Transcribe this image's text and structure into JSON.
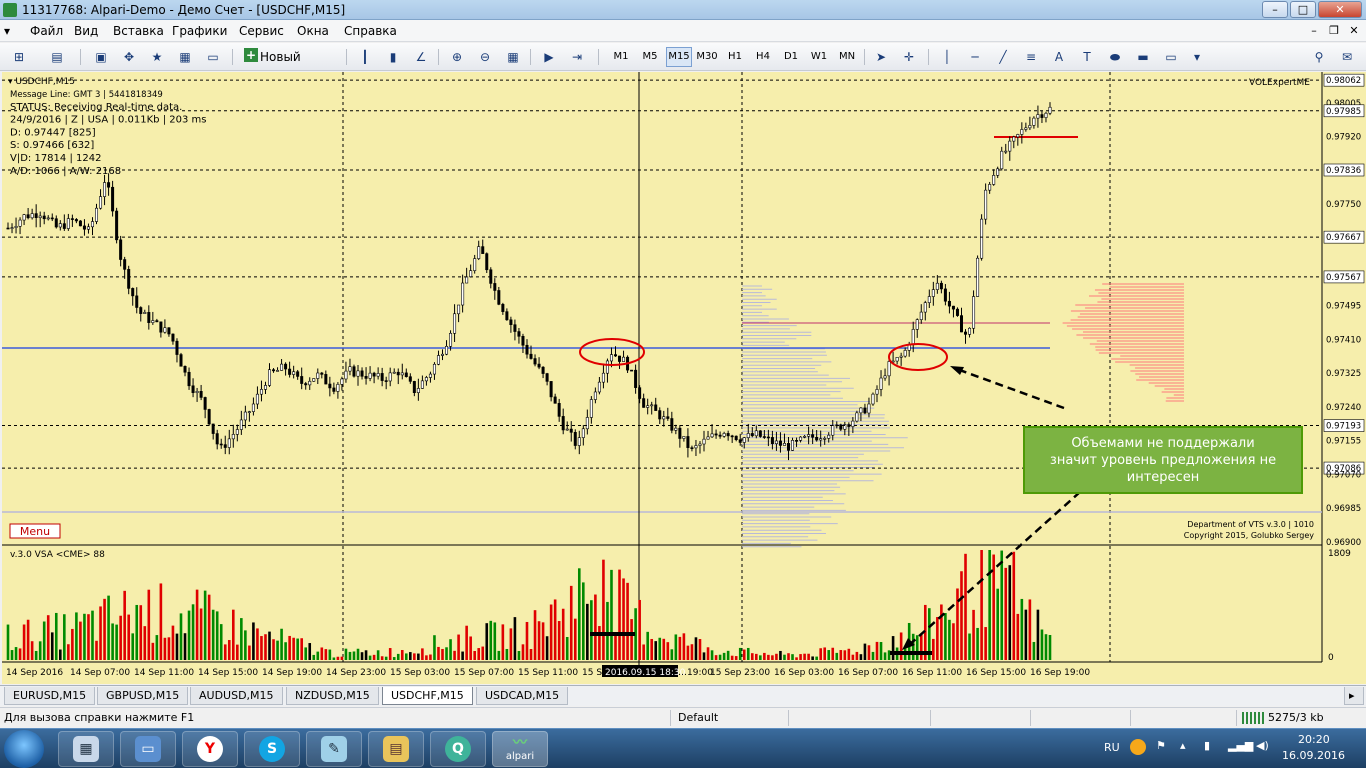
{
  "window": {
    "title": "11317768: Alpari-Demo - Демо Счет - [USDCHF,M15]",
    "controls": {
      "minimize": "–",
      "maximize": "□",
      "close": "✕"
    }
  },
  "menu": {
    "items": [
      "Файл",
      "Вид",
      "Вставка",
      "Графики",
      "Сервис",
      "Окна",
      "Справка"
    ],
    "mdi_controls": [
      "–",
      "❐",
      "✕"
    ]
  },
  "toolbar": {
    "new_order_label": "Новый ордер",
    "timeframes": [
      "M1",
      "M5",
      "M15",
      "M30",
      "H1",
      "H4",
      "D1",
      "W1",
      "MN"
    ],
    "active_timeframe": "M15",
    "text_tool": "A"
  },
  "chart_header": {
    "symbol": "USDCHF,M15",
    "info_lines": [
      "Message Line: GMT 3 | 5441818349",
      "STATUS:  Receiving Real-time data.",
      "24/9/2016 | Z | USA | 0.011Kb | 203 ms",
      "D: 0.97447  [825]",
      "S: 0.97466  [632]",
      "V|D: 17814 | 1242",
      "A/D: 1066 | A/W: 2168"
    ],
    "expert_name": "VOLExpertME",
    "menu_button": "Menu",
    "copyright_lines": [
      "Department of VTS  v.3.0 | 1010",
      "Copyright 2015, Golubko Sergey"
    ]
  },
  "annotation": {
    "text_lines": [
      "Объемами не поддержали",
      "значит уровень предложения не",
      "интересен"
    ],
    "colors": {
      "border": "#4e9a06",
      "text": "#ffffff",
      "fill": "#7cb342"
    }
  },
  "colors": {
    "chart_bg": "#f6eeac",
    "candles": "#000000",
    "level_line": "#3b5bdb",
    "red": "#e00000",
    "green": "#008a00",
    "volume_profile": "#b8b9d8"
  },
  "chart_data": [
    {
      "type": "candlestick",
      "series": [
        {
          "name": "USDCHF,M15"
        }
      ],
      "x": [
        "14 Sep 2016",
        "14 Sep 07:00",
        "14 Sep 11:00",
        "14 Sep 15:00",
        "14 Sep 19:00",
        "14 Sep 23:00",
        "15 Sep 03:00",
        "15 Sep 07:00",
        "15 Sep 11:00",
        "15 Sep 1…",
        "2016.09.15 18:30",
        "…19:00",
        "15 Sep 23:00",
        "16 Sep 03:00",
        "16 Sep 07:00",
        "16 Sep 11:00",
        "16 Sep 15:00",
        "16 Sep 19:00"
      ],
      "y_ticks": [
        "0.98062",
        "0.98005",
        "0.97985",
        "0.97920",
        "0.97836",
        "0.97750",
        "0.97667",
        "0.97567",
        "0.97495",
        "0.97410",
        "0.97325",
        "0.97240",
        "0.97193",
        "0.97155",
        "0.97086",
        "0.97070",
        "0.96985",
        "0.96900"
      ],
      "highlighted_ticks": [
        "0.98062",
        "0.97985",
        "0.97836",
        "0.97667",
        "0.97567",
        "0.97193",
        "0.97086"
      ],
      "ylim": [
        0.969,
        0.9807
      ],
      "close_approx": [
        0.9769,
        0.9772,
        0.9773,
        0.9769,
        0.9771,
        0.9768,
        0.9782,
        0.976,
        0.9748,
        0.9745,
        0.9742,
        0.9731,
        0.9725,
        0.9713,
        0.9718,
        0.9724,
        0.9732,
        0.9734,
        0.973,
        0.9732,
        0.9729,
        0.9733,
        0.9732,
        0.9731,
        0.9733,
        0.9728,
        0.9733,
        0.9741,
        0.9755,
        0.9764,
        0.9752,
        0.9744,
        0.9737,
        0.9731,
        0.972,
        0.9714,
        0.9728,
        0.9738,
        0.9735,
        0.9725,
        0.9722,
        0.9718,
        0.9713,
        0.9716,
        0.9718,
        0.9716,
        0.9717,
        0.9715,
        0.9714,
        0.9716,
        0.9717,
        0.9719,
        0.9721,
        0.9725,
        0.9734,
        0.9737,
        0.9747,
        0.9756,
        0.9748,
        0.9741,
        0.9778,
        0.9787,
        0.9792,
        0.9797,
        0.9799
      ],
      "level_line_price": 0.9738,
      "red_levels_right": [
        0.9792
      ],
      "volume_profile_peak_price": 0.9726
    },
    {
      "type": "bar",
      "title": "v.3.0 VSA <CME> 88",
      "y_ticks": [
        "1809",
        "0"
      ],
      "ylim": [
        0,
        1809
      ],
      "categories": [
        "14 Sep 2016",
        "14 Sep 07:00",
        "14 Sep 11:00",
        "14 Sep 15:00",
        "14 Sep 19:00",
        "14 Sep 23:00",
        "15 Sep 03:00",
        "15 Sep 07:00",
        "15 Sep 11:00",
        "15 Sep 1…",
        "15 Sep 19:00",
        "15 Sep 23:00",
        "16 Sep 03:00",
        "16 Sep 07:00",
        "16 Sep 11:00",
        "16 Sep 15:00",
        "16 Sep 19:00"
      ],
      "values": [
        420,
        560,
        900,
        780,
        410,
        120,
        150,
        380,
        510,
        1350,
        460,
        160,
        90,
        180,
        520,
        1540,
        380
      ]
    }
  ],
  "chart_tabs": [
    "EURUSD,M15",
    "GBPUSD,M15",
    "AUDUSD,M15",
    "NZDUSD,M15",
    "USDCHF,M15",
    "USDCAD,M15"
  ],
  "active_tab": "USDCHF,M15",
  "statusbar": {
    "help": "Для вызова справки нажмите F1",
    "profile": "Default",
    "traffic": "5275/3 kb"
  },
  "taskbar": {
    "apps": [
      "calculator",
      "computer",
      "yandex",
      "skype",
      "notepad",
      "explorer",
      "qip"
    ],
    "active_app_label": "alpari",
    "lang": "RU",
    "time": "20:20",
    "date": "16.09.2016"
  }
}
